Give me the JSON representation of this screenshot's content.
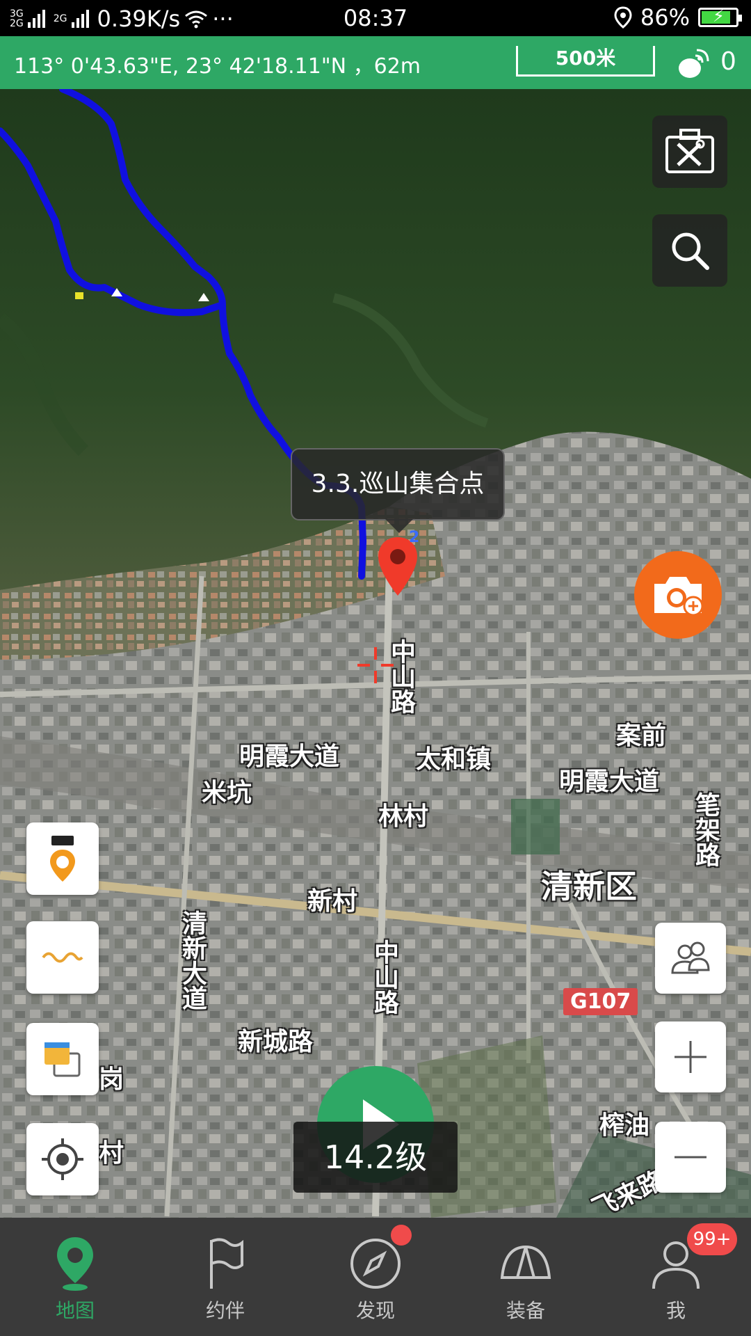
{
  "status_bar": {
    "network_small_top": "3G",
    "network_small_bottom": "2G",
    "network_small2": "2G",
    "speed": "0.39K/s",
    "more": "···",
    "time": "08:37",
    "battery_text": "86%",
    "battery_level": 0.86
  },
  "coord_bar": {
    "coordinates": "113°  0'43.63\"E,  23°  42'18.11\"N ，62m",
    "scale_label": "500米",
    "satellite_count": "0"
  },
  "map": {
    "callout_label": "3.3.巡山集合点",
    "pin_number": "2",
    "labels": {
      "zhongshan_road_1": "中山路",
      "mingxia_avenue_1": "明霞大道",
      "taihe_town": "太和镇",
      "anqian": "案前",
      "mingxia_avenue_2": "明霞大道",
      "mikeng": "米坑",
      "lincun": "林村",
      "bijia_road": "笔架路",
      "xincun": "新村",
      "qingxin_district": "清新区",
      "qingxin_avenue": "清新大道",
      "zhongshan_road_2": "中山路",
      "g107": "G107",
      "xincheng_road": "新城路",
      "zhayou": "榨油",
      "feilai_road": "飞来路",
      "cun": "村",
      "gang": "岗"
    },
    "zoom_level": "14.2级"
  },
  "bottom_nav": {
    "items": [
      {
        "label": "地图",
        "icon": "map-pin-icon",
        "active": true
      },
      {
        "label": "约伴",
        "icon": "flag-icon",
        "active": false
      },
      {
        "label": "发现",
        "icon": "compass-icon",
        "active": false
      },
      {
        "label": "装备",
        "icon": "tent-icon",
        "active": false
      },
      {
        "label": "我",
        "icon": "user-icon",
        "active": false
      }
    ],
    "me_badge": "99+"
  },
  "colors": {
    "primary_green": "#2ea865",
    "camera_orange": "#f26a1b",
    "badge_red": "#f04b4b",
    "track_blue": "#1010e0"
  }
}
